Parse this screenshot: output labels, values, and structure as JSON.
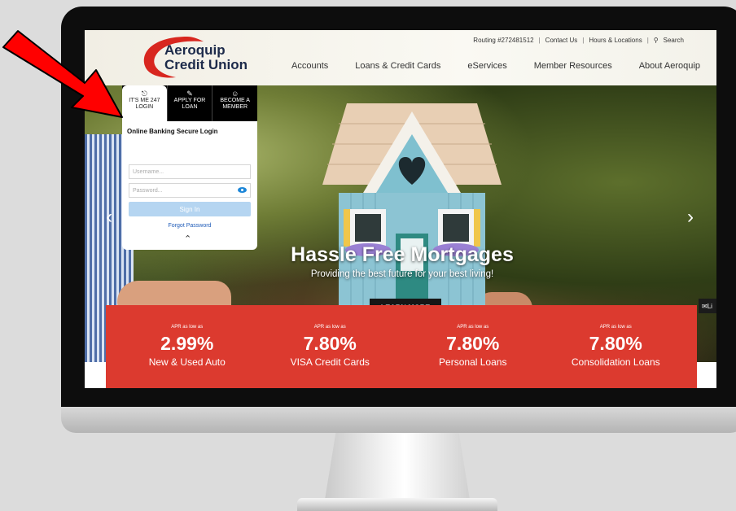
{
  "header": {
    "logo_line1": "Aeroquip",
    "logo_line2": "Credit Union",
    "util_nav": {
      "routing": "Routing #272481512",
      "contact": "Contact Us",
      "hours": "Hours & Locations",
      "search": "Search"
    },
    "main_nav": [
      "Accounts",
      "Loans & Credit Cards",
      "eServices",
      "Member Resources",
      "About Aeroquip"
    ]
  },
  "login": {
    "tabs": [
      {
        "icon": "lock-icon",
        "line1": "IT'S ME 247",
        "line2": "LOGIN"
      },
      {
        "icon": "edit-icon",
        "line1": "APPLY FOR",
        "line2": "LOAN"
      },
      {
        "icon": "user-icon",
        "line1": "BECOME A",
        "line2": "MEMBER"
      }
    ],
    "title": "Online Banking Secure Login",
    "username_placeholder": "Username...",
    "password_placeholder": "Password...",
    "sign_in": "Sign In",
    "forgot": "Forgot Password"
  },
  "hero": {
    "title": "Hassle Free Mortgages",
    "subtitle": "Providing the best future for your best living!",
    "cta": "LEARN MORE",
    "chat_label": "Li"
  },
  "rates": [
    {
      "apr": "APR as low as",
      "value": "2.99%",
      "product": "New & Used Auto"
    },
    {
      "apr": "APR as low as",
      "value": "7.80%",
      "product": "VISA Credit Cards"
    },
    {
      "apr": "APR as low as",
      "value": "7.80%",
      "product": "Personal Loans"
    },
    {
      "apr": "APR as low as",
      "value": "7.80%",
      "product": "Consolidation Loans"
    }
  ],
  "colors": {
    "brand_red": "#dc3a2f",
    "brand_navy": "#1c2a4a",
    "link_blue": "#1e5bb8",
    "annotation_arrow": "#ff0000"
  }
}
